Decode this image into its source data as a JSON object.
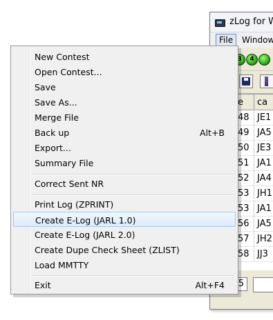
{
  "app_window": {
    "title": "zLog for W",
    "menubar": {
      "file": "File",
      "window": "Window"
    },
    "band_buttons": [
      "3",
      "4"
    ],
    "log": {
      "col_serial": "e",
      "col_call": "ca",
      "rows": [
        {
          "serial": "48",
          "call": "JE1"
        },
        {
          "serial": "49",
          "call": "JA5"
        },
        {
          "serial": "50",
          "call": "JE3"
        },
        {
          "serial": "51",
          "call": "JA1"
        },
        {
          "serial": "52",
          "call": "JA4"
        },
        {
          "serial": "53",
          "call": "JH1"
        },
        {
          "serial": "53",
          "call": "JA1"
        },
        {
          "serial": "56",
          "call": "JA5"
        },
        {
          "serial": "57",
          "call": "JH2"
        },
        {
          "serial": "58",
          "call": "JJ3"
        }
      ],
      "input_serial": "5"
    }
  },
  "file_menu": {
    "items": [
      {
        "label": "New Contest",
        "shortcut": ""
      },
      {
        "label": "Open Contest...",
        "shortcut": ""
      },
      {
        "label": "Save",
        "shortcut": ""
      },
      {
        "label": "Save As...",
        "shortcut": ""
      },
      {
        "label": "Merge File",
        "shortcut": ""
      },
      {
        "label": "Back up",
        "shortcut": "Alt+B"
      },
      {
        "label": "Export...",
        "shortcut": ""
      },
      {
        "label": "Summary File",
        "shortcut": ""
      },
      {
        "label": "Correct Sent NR",
        "shortcut": ""
      },
      {
        "label": "Print Log (ZPRINT)",
        "shortcut": ""
      },
      {
        "label": "Create E-Log (JARL 1.0)",
        "shortcut": ""
      },
      {
        "label": "Create E-Log (JARL 2.0)",
        "shortcut": ""
      },
      {
        "label": "Create Dupe Check Sheet (ZLIST)",
        "shortcut": ""
      },
      {
        "label": "Load MMTTY",
        "shortcut": ""
      },
      {
        "label": "Exit",
        "shortcut": "Alt+F4"
      }
    ]
  },
  "colors": {
    "menu_background": "#f0f0f0",
    "menu_highlight": "#dcebfb",
    "menu_highlight_border": "#a8c8ec",
    "band_button": "#1f9b12"
  }
}
